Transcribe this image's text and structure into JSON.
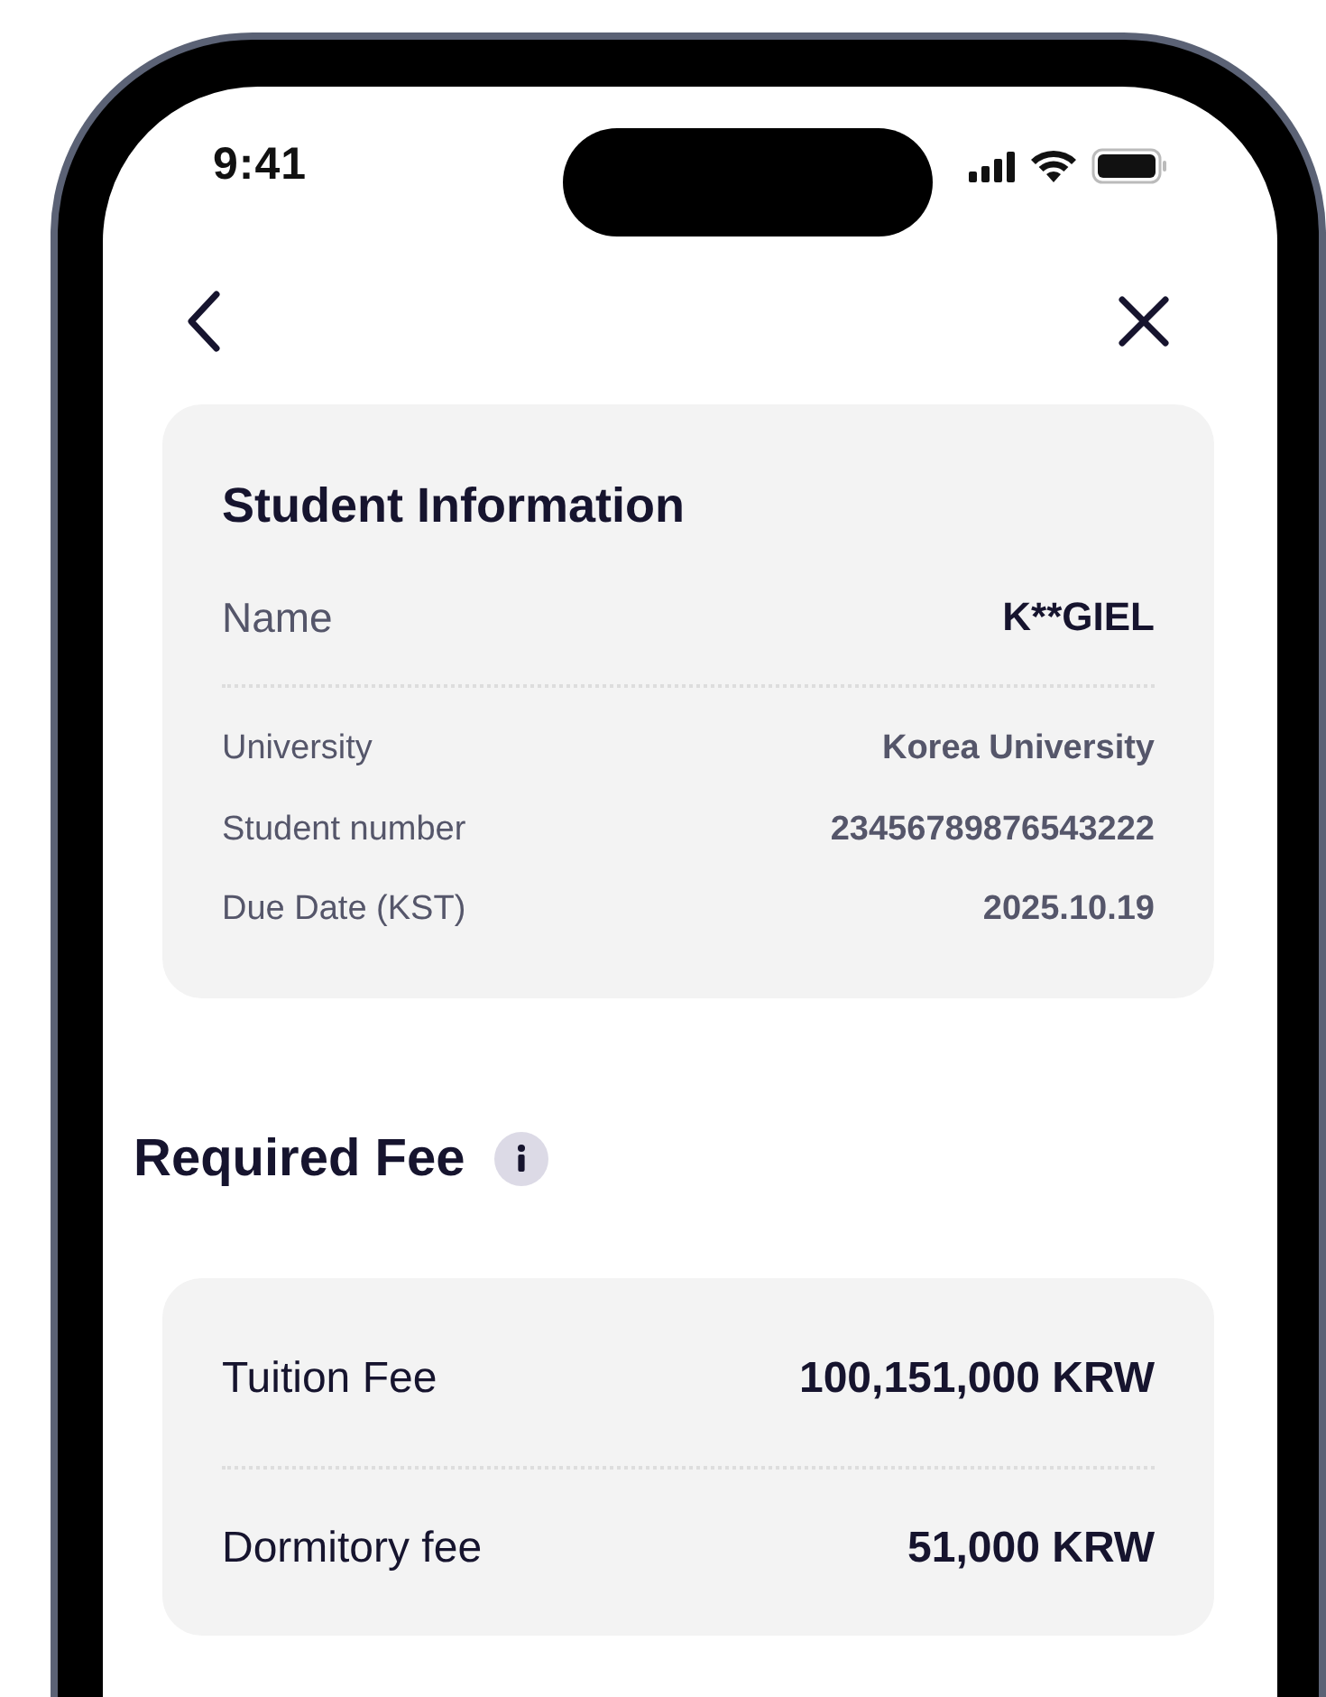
{
  "status_bar": {
    "time": "9:41"
  },
  "student_info": {
    "title": "Student Information",
    "name_row": {
      "label": "Name",
      "value": "K**GIEL"
    },
    "rows": [
      {
        "label": "University",
        "value": "Korea University"
      },
      {
        "label": "Student number",
        "value": "23456789876543222"
      },
      {
        "label": "Due Date (KST)",
        "value": "2025.10.19"
      }
    ]
  },
  "required_fee": {
    "title": "Required Fee",
    "rows": [
      {
        "label": "Tuition Fee",
        "value": "100,151,000 KRW"
      },
      {
        "label": "Dormitory fee",
        "value": "51,000 KRW"
      }
    ]
  }
}
